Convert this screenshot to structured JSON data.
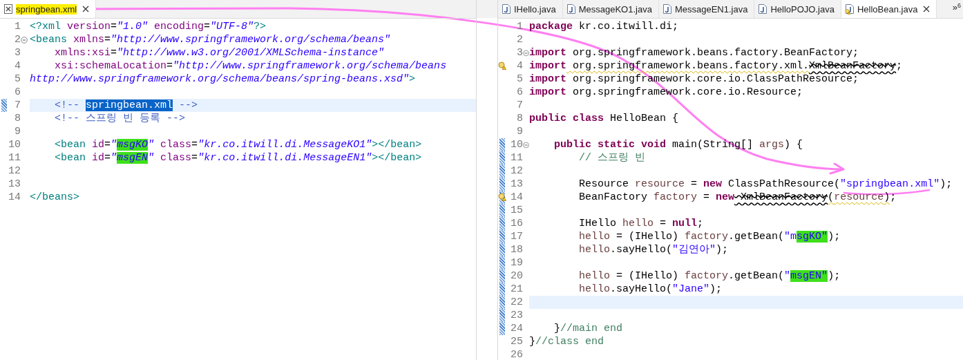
{
  "left_editor": {
    "tabs": [
      {
        "label": "springbean.xml",
        "kind": "xml",
        "selected": true,
        "marked": true,
        "warning": false
      }
    ],
    "lines": [
      {
        "number": "1",
        "changed": false,
        "current": false,
        "collapsible": false,
        "warning": false,
        "tokens": [
          {
            "kind": "tag",
            "text": "<?xml"
          },
          {
            "kind": "attr",
            "text": " version"
          },
          {
            "kind": "plain",
            "text": "="
          },
          {
            "kind": "value",
            "text": "\"1.0\""
          },
          {
            "kind": "attr",
            "text": " encoding"
          },
          {
            "kind": "plain",
            "text": "="
          },
          {
            "kind": "value",
            "text": "\"UTF-8\""
          },
          {
            "kind": "tag",
            "text": "?>"
          }
        ]
      },
      {
        "number": "2",
        "changed": false,
        "current": false,
        "collapsible": true,
        "warning": false,
        "tokens": [
          {
            "kind": "tag",
            "text": "<beans"
          },
          {
            "kind": "attr",
            "text": " xmlns"
          },
          {
            "kind": "plain",
            "text": "="
          },
          {
            "kind": "value",
            "text": "\"http://www.springframework.org/schema/beans\""
          }
        ]
      },
      {
        "number": "3",
        "changed": false,
        "current": false,
        "collapsible": false,
        "warning": false,
        "tokens": [
          {
            "kind": "attr",
            "text": "    xmlns:xsi"
          },
          {
            "kind": "plain",
            "text": "="
          },
          {
            "kind": "value",
            "text": "\"http://www.w3.org/2001/XMLSchema-instance\""
          }
        ]
      },
      {
        "number": "4",
        "changed": false,
        "current": false,
        "collapsible": false,
        "warning": false,
        "tokens": [
          {
            "kind": "attr",
            "text": "    xsi:schemaLocation"
          },
          {
            "kind": "plain",
            "text": "="
          },
          {
            "kind": "value",
            "text": "\"http://www.springframework.org/schema/beans"
          }
        ]
      },
      {
        "number": "5",
        "changed": false,
        "current": false,
        "collapsible": false,
        "warning": false,
        "tokens": [
          {
            "kind": "value",
            "text": "http://www.springframework.org/schema/beans/spring-beans.xsd\""
          },
          {
            "kind": "tag",
            "text": ">"
          }
        ]
      },
      {
        "number": "6",
        "changed": false,
        "current": false,
        "collapsible": false,
        "warning": false
      },
      {
        "number": "7",
        "changed": true,
        "current": true,
        "collapsible": false,
        "warning": false,
        "tokens": [
          {
            "kind": "xmlcomment",
            "text": "    <!-- "
          },
          {
            "kind": "xmlcomment",
            "text": "springbean.xml",
            "selected": true
          },
          {
            "kind": "xmlcomment",
            "text": " -->"
          }
        ]
      },
      {
        "number": "8",
        "changed": false,
        "current": false,
        "collapsible": false,
        "warning": false,
        "tokens": [
          {
            "kind": "xmlcomment",
            "text": "    <!-- 스프링 빈 등록 -->"
          }
        ]
      },
      {
        "number": "9",
        "changed": false,
        "current": false,
        "collapsible": false,
        "warning": false
      },
      {
        "number": "10",
        "changed": false,
        "current": false,
        "collapsible": false,
        "warning": false,
        "tokens": [
          {
            "kind": "tag",
            "text": "    <bean"
          },
          {
            "kind": "attr",
            "text": " id"
          },
          {
            "kind": "plain",
            "text": "="
          },
          {
            "kind": "value",
            "text": "\""
          },
          {
            "kind": "value",
            "text": "msgKO",
            "marked": true
          },
          {
            "kind": "value",
            "text": "\""
          },
          {
            "kind": "attr",
            "text": " class"
          },
          {
            "kind": "plain",
            "text": "="
          },
          {
            "kind": "value",
            "text": "\"kr.co.itwill.di.MessageKO1\""
          },
          {
            "kind": "tag",
            "text": "></bean>"
          }
        ]
      },
      {
        "number": "11",
        "changed": false,
        "current": false,
        "collapsible": false,
        "warning": false,
        "tokens": [
          {
            "kind": "tag",
            "text": "    <bean"
          },
          {
            "kind": "attr",
            "text": " id"
          },
          {
            "kind": "plain",
            "text": "="
          },
          {
            "kind": "value",
            "text": "\""
          },
          {
            "kind": "value",
            "text": "msgEN",
            "marked": true
          },
          {
            "kind": "value",
            "text": "\""
          },
          {
            "kind": "attr",
            "text": " class"
          },
          {
            "kind": "plain",
            "text": "="
          },
          {
            "kind": "value",
            "text": "\"kr.co.itwill.di.MessageEN1\""
          },
          {
            "kind": "tag",
            "text": "></bean>"
          }
        ]
      },
      {
        "number": "12",
        "changed": false,
        "current": false,
        "collapsible": false,
        "warning": false
      },
      {
        "number": "13",
        "changed": false,
        "current": false,
        "collapsible": false,
        "warning": false
      },
      {
        "number": "14",
        "changed": false,
        "current": false,
        "collapsible": false,
        "warning": false,
        "tokens": [
          {
            "kind": "tag",
            "text": "</beans>"
          }
        ]
      }
    ]
  },
  "right_editor": {
    "tabs": [
      {
        "label": "IHello.java",
        "kind": "java",
        "selected": false,
        "marked": false,
        "warning": false
      },
      {
        "label": "MessageKO1.java",
        "kind": "java",
        "selected": false,
        "marked": false,
        "warning": false
      },
      {
        "label": "MessageEN1.java",
        "kind": "java",
        "selected": false,
        "marked": false,
        "warning": false
      },
      {
        "label": "HelloPOJO.java",
        "kind": "java",
        "selected": false,
        "marked": false,
        "warning": false
      },
      {
        "label": "HelloBean.java",
        "kind": "java",
        "selected": true,
        "marked": false,
        "warning": true
      }
    ],
    "overflow": {
      "symbol": "»",
      "count": "6"
    },
    "lines": [
      {
        "number": "1",
        "changed": false,
        "current": false,
        "collapsible": false,
        "warning": false,
        "tokens": [
          {
            "kind": "keyword",
            "text": "package"
          },
          {
            "kind": "plain",
            "text": " kr.co.itwill.di;"
          }
        ]
      },
      {
        "number": "2",
        "changed": false,
        "current": false,
        "collapsible": false,
        "warning": false
      },
      {
        "number": "3",
        "changed": false,
        "current": false,
        "collapsible": true,
        "warning": false,
        "tokens": [
          {
            "kind": "keyword",
            "text": "import"
          },
          {
            "kind": "plain",
            "text": " org.springframework.beans.factory.BeanFactory;"
          }
        ]
      },
      {
        "number": "4",
        "changed": false,
        "current": false,
        "collapsible": false,
        "warning": true,
        "tokens": [
          {
            "kind": "keyword",
            "text": "import"
          },
          {
            "kind": "plain",
            "text": " org.springframework.beans.factory.xml.",
            "warning": true
          },
          {
            "kind": "deprecated",
            "text": "XmlBeanFactory",
            "warning": true
          },
          {
            "kind": "plain",
            "text": ";"
          }
        ]
      },
      {
        "number": "5",
        "changed": false,
        "current": false,
        "collapsible": false,
        "warning": false,
        "tokens": [
          {
            "kind": "keyword",
            "text": "import"
          },
          {
            "kind": "plain",
            "text": " org.springframework.core.io.ClassPathResource;"
          }
        ]
      },
      {
        "number": "6",
        "changed": false,
        "current": false,
        "collapsible": false,
        "warning": false,
        "tokens": [
          {
            "kind": "keyword",
            "text": "import"
          },
          {
            "kind": "plain",
            "text": " org.springframework.core.io.Resource;"
          }
        ]
      },
      {
        "number": "7",
        "changed": false,
        "current": false,
        "collapsible": false,
        "warning": false
      },
      {
        "number": "8",
        "changed": false,
        "current": false,
        "collapsible": false,
        "warning": false,
        "tokens": [
          {
            "kind": "keyword",
            "text": "public"
          },
          {
            "kind": "keyword",
            "text": " class"
          },
          {
            "kind": "plain",
            "text": " HelloBean {"
          }
        ]
      },
      {
        "number": "9",
        "changed": false,
        "current": false,
        "collapsible": false,
        "warning": false
      },
      {
        "number": "10",
        "changed": true,
        "current": false,
        "collapsible": true,
        "warning": false,
        "tokens": [
          {
            "kind": "keyword",
            "text": "    public"
          },
          {
            "kind": "keyword",
            "text": " static"
          },
          {
            "kind": "keyword",
            "text": " void"
          },
          {
            "kind": "plain",
            "text": " main(String[] "
          },
          {
            "kind": "variable",
            "text": "args"
          },
          {
            "kind": "plain",
            "text": ") {"
          }
        ]
      },
      {
        "number": "11",
        "changed": true,
        "current": false,
        "collapsible": false,
        "warning": false,
        "tokens": [
          {
            "kind": "comment",
            "text": "        // 스프링 빈"
          }
        ]
      },
      {
        "number": "12",
        "changed": true,
        "current": false,
        "collapsible": false,
        "warning": false
      },
      {
        "number": "13",
        "changed": true,
        "current": false,
        "collapsible": false,
        "warning": false,
        "tokens": [
          {
            "kind": "plain",
            "text": "        Resource "
          },
          {
            "kind": "variable",
            "text": "resource"
          },
          {
            "kind": "plain",
            "text": " = "
          },
          {
            "kind": "keyword",
            "text": "new"
          },
          {
            "kind": "plain",
            "text": " ClassPathResource("
          },
          {
            "kind": "string",
            "text": "\"springbean.xml\""
          },
          {
            "kind": "plain",
            "text": ");"
          }
        ]
      },
      {
        "number": "14",
        "changed": true,
        "current": false,
        "collapsible": false,
        "warning": true,
        "tokens": [
          {
            "kind": "plain",
            "text": "        BeanFactory "
          },
          {
            "kind": "variable",
            "text": "factory"
          },
          {
            "kind": "plain",
            "text": " = "
          },
          {
            "kind": "keyword",
            "text": "new"
          },
          {
            "kind": "deprecated",
            "text": " XmlBeanFactory",
            "warning": true
          },
          {
            "kind": "plain",
            "text": "(",
            "warning": true
          },
          {
            "kind": "variable",
            "text": "resource",
            "warning": true
          },
          {
            "kind": "plain",
            "text": ")",
            "warning": true
          },
          {
            "kind": "plain",
            "text": ";"
          }
        ]
      },
      {
        "number": "15",
        "changed": true,
        "current": false,
        "collapsible": false,
        "warning": false
      },
      {
        "number": "16",
        "changed": true,
        "current": false,
        "collapsible": false,
        "warning": false,
        "tokens": [
          {
            "kind": "plain",
            "text": "        IHello "
          },
          {
            "kind": "variable",
            "text": "hello"
          },
          {
            "kind": "plain",
            "text": " = "
          },
          {
            "kind": "keyword",
            "text": "null"
          },
          {
            "kind": "plain",
            "text": ";"
          }
        ]
      },
      {
        "number": "17",
        "changed": true,
        "current": false,
        "collapsible": false,
        "warning": false,
        "tokens": [
          {
            "kind": "variable",
            "text": "        hello"
          },
          {
            "kind": "plain",
            "text": " = (IHello) "
          },
          {
            "kind": "variable",
            "text": "factory"
          },
          {
            "kind": "plain",
            "text": ".getBean("
          },
          {
            "kind": "string",
            "text": "\"m"
          },
          {
            "kind": "string",
            "text": "sgKO\"",
            "marked": true
          },
          {
            "kind": "plain",
            "text": ");"
          }
        ]
      },
      {
        "number": "18",
        "changed": true,
        "current": false,
        "collapsible": false,
        "warning": false,
        "tokens": [
          {
            "kind": "variable",
            "text": "        hello"
          },
          {
            "kind": "plain",
            "text": ".sayHello("
          },
          {
            "kind": "string",
            "text": "\"김연아\""
          },
          {
            "kind": "plain",
            "text": ");"
          }
        ]
      },
      {
        "number": "19",
        "changed": true,
        "current": false,
        "collapsible": false,
        "warning": false
      },
      {
        "number": "20",
        "changed": true,
        "current": false,
        "collapsible": false,
        "warning": false,
        "tokens": [
          {
            "kind": "variable",
            "text": "        hello"
          },
          {
            "kind": "plain",
            "text": " = (IHello) "
          },
          {
            "kind": "variable",
            "text": "factory"
          },
          {
            "kind": "plain",
            "text": ".getBean("
          },
          {
            "kind": "string",
            "text": "\""
          },
          {
            "kind": "string",
            "text": "msgEN\"",
            "marked": true
          },
          {
            "kind": "plain",
            "text": ");"
          }
        ]
      },
      {
        "number": "21",
        "changed": true,
        "current": false,
        "collapsible": false,
        "warning": false,
        "tokens": [
          {
            "kind": "variable",
            "text": "        hello"
          },
          {
            "kind": "plain",
            "text": ".sayHello("
          },
          {
            "kind": "string",
            "text": "\"Jane\""
          },
          {
            "kind": "plain",
            "text": ");"
          }
        ]
      },
      {
        "number": "22",
        "changed": true,
        "current": true,
        "collapsible": false,
        "warning": false
      },
      {
        "number": "23",
        "changed": true,
        "current": false,
        "collapsible": false,
        "warning": false
      },
      {
        "number": "24",
        "changed": true,
        "current": false,
        "collapsible": false,
        "warning": false,
        "tokens": [
          {
            "kind": "plain",
            "text": "    }"
          },
          {
            "kind": "comment",
            "text": "//main end"
          }
        ]
      },
      {
        "number": "25",
        "changed": false,
        "current": false,
        "collapsible": false,
        "warning": false,
        "tokens": [
          {
            "kind": "plain",
            "text": "}"
          },
          {
            "kind": "comment",
            "text": "//class end"
          }
        ]
      },
      {
        "number": "26",
        "changed": false,
        "current": false,
        "collapsible": false,
        "warning": false
      }
    ]
  }
}
